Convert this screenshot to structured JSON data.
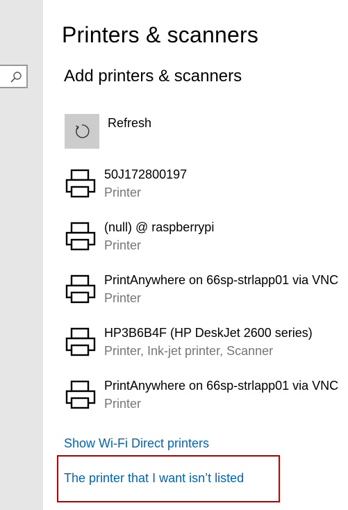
{
  "header": {
    "title": "Printers & scanners"
  },
  "section": {
    "title": "Add printers & scanners"
  },
  "refresh": {
    "label": "Refresh"
  },
  "devices": [
    {
      "name": "50J172800197",
      "type": "Printer"
    },
    {
      "name": "(null) @ raspberrypi",
      "type": "Printer"
    },
    {
      "name": "PrintAnywhere on 66sp-strlapp01 via VNC ",
      "type": "Printer"
    },
    {
      "name": "HP3B6B4F (HP DeskJet 2600 series)",
      "type": "Printer, Ink-jet printer, Scanner"
    },
    {
      "name": "PrintAnywhere on 66sp-strlapp01 via VNC ",
      "type": "Printer"
    }
  ],
  "links": {
    "wifi_direct": "Show Wi-Fi Direct printers",
    "not_listed": "The printer that I want isn’t listed"
  },
  "colors": {
    "accent_link": "#0066b4",
    "highlight": "#c00000",
    "sidebar_bg": "#e6e6e6",
    "refresh_bg": "#cccccc"
  }
}
